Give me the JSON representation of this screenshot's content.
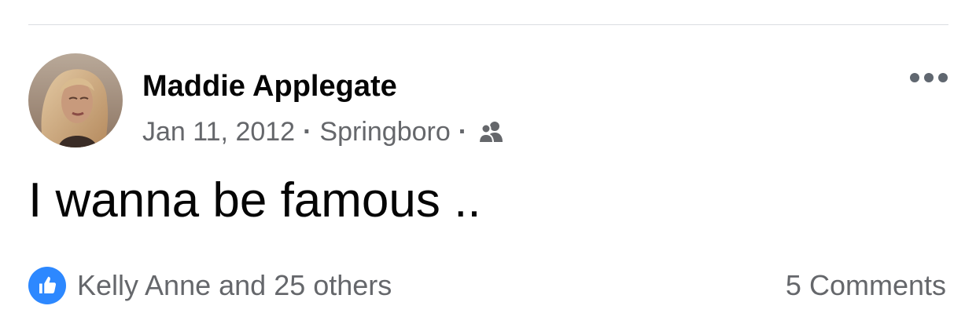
{
  "post": {
    "author_name": "Maddie Applegate",
    "date": "Jan 11, 2012",
    "location": "Springboro",
    "separator": "·",
    "audience_icon": "friends-icon",
    "more_icon": "more-horizontal-icon",
    "text": "I wanna be famous ..",
    "reactions": {
      "icon": "like-icon",
      "summary": "Kelly Anne and 25 others"
    },
    "comments": "5 Comments"
  },
  "colors": {
    "primary_text": "#050505",
    "secondary_text": "#65676b",
    "like_blue": "#2d88ff",
    "divider": "#dadde1"
  }
}
